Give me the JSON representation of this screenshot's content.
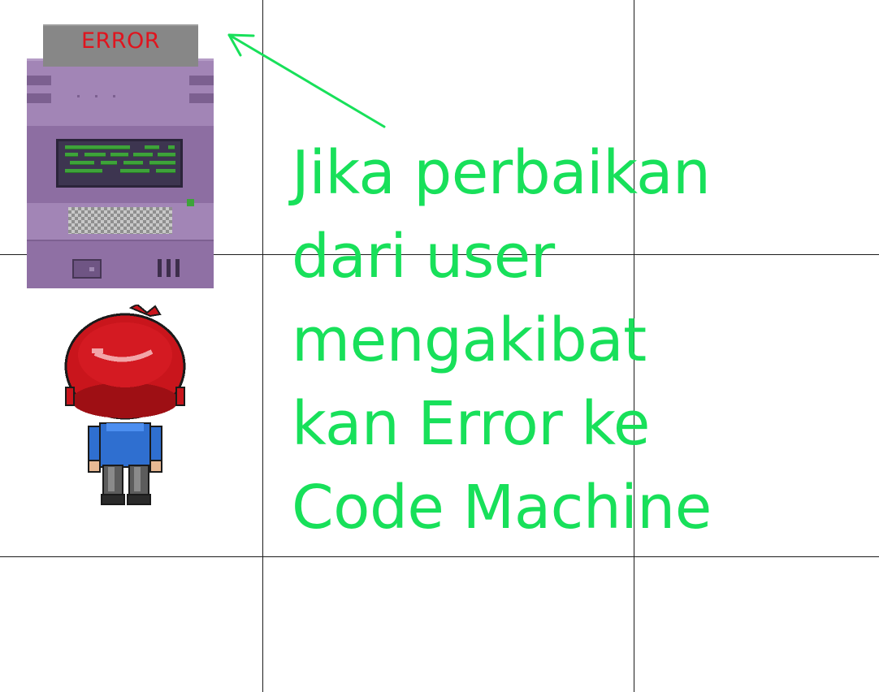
{
  "scene": {
    "background_color": "#ffffff",
    "grid_line_color": "#1c1c1c"
  },
  "code_machine": {
    "display_text": "ERROR",
    "display_text_color": "#e0141e",
    "body_color": "#a285b6",
    "screen_code_color": "#3ea33a"
  },
  "annotation": {
    "arrow_color": "#18e05a",
    "text_color": "#18e05a",
    "lines": [
      "Jika perbaikan",
      "dari user",
      "mengakibat",
      "kan Error ke",
      "Code Machine"
    ]
  },
  "player": {
    "hair_color": "#c9151c",
    "shirt_color": "#2f6fd0",
    "pants_color": "#5c5c5c",
    "facing": "away"
  }
}
